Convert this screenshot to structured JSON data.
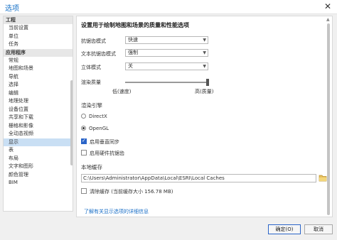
{
  "window": {
    "title": "选项",
    "close_glyph": "✕"
  },
  "sidebar": {
    "sections": [
      {
        "label": "工程",
        "items": [
          "当前设置",
          "单位",
          "任务"
        ]
      },
      {
        "label": "应用程序",
        "items": [
          "常规",
          "地图和场景",
          "导航",
          "选择",
          "编辑",
          "地理处理",
          "设备位置",
          "共享和下载",
          "栅格和影像",
          "全动态视频",
          "显示",
          "表",
          "布局",
          "文字和图形",
          "颜色管理",
          "BIM"
        ]
      }
    ],
    "selected": "显示"
  },
  "content": {
    "heading": "设置用于绘制地图和场景的质量和性能选项",
    "antialias": {
      "label": "抗锯齿模式",
      "value": "快速"
    },
    "text_antialias": {
      "label": "文本抗锯齿模式",
      "value": "强制"
    },
    "stereo": {
      "label": "立体模式",
      "value": "关"
    },
    "render_quality": {
      "label": "渲染质量",
      "low": "低(速度)",
      "high": "高(质量)",
      "level": 1.0
    },
    "engine": {
      "heading": "渲染引擎",
      "directx": "DirectX",
      "opengl": "OpenGL",
      "selected": "OpenGL"
    },
    "vsync": {
      "label": "启用垂直同步",
      "checked": true
    },
    "hw_aa": {
      "label": "启用硬件抗锯齿",
      "checked": false
    },
    "cache": {
      "heading": "本地缓存",
      "path": "C:\\Users\\Administrator\\AppData\\Local\\ESRI\\Local Caches",
      "clear_label": "清除缓存 (当前缓存大小 156.78 MB)",
      "clear_checked": false
    },
    "more_link": "了解有关显示选项的详细信息"
  },
  "buttons": {
    "ok": "确定(O)",
    "cancel": "取消"
  },
  "colors": {
    "accent": "#2a64c8",
    "selected_bg": "#c9dff4",
    "link": "#1a6fc7"
  }
}
